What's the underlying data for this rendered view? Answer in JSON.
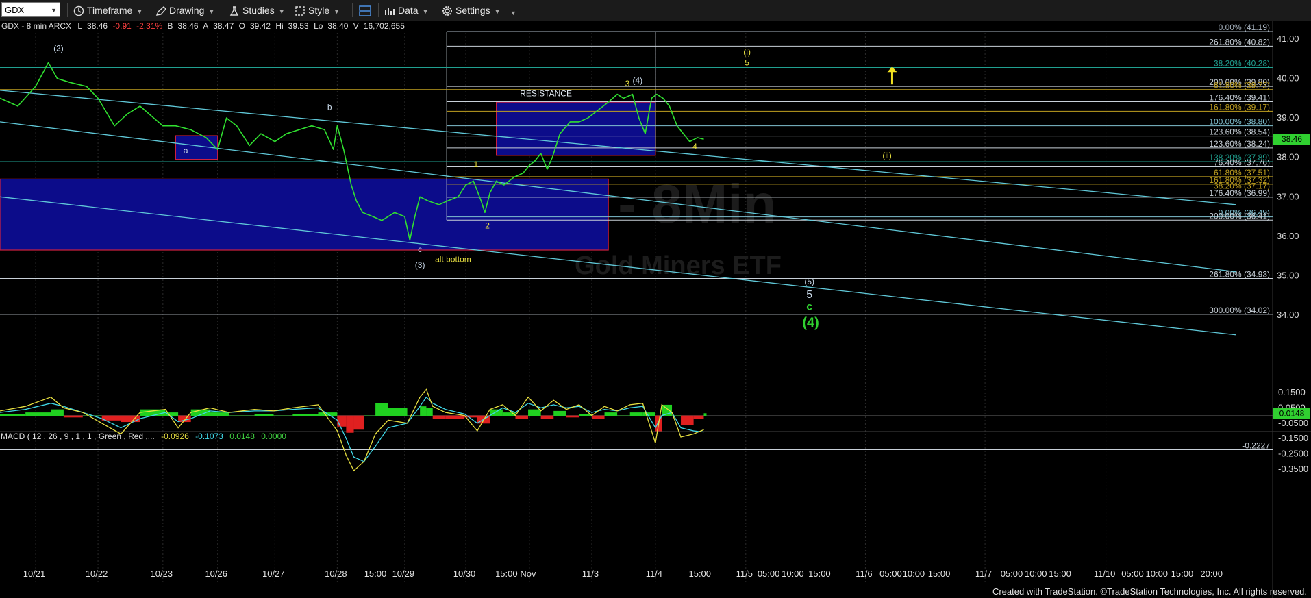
{
  "toolbar": {
    "symbol": "GDX",
    "timeframe": "Timeframe",
    "drawing": "Drawing",
    "studies": "Studies",
    "style": "Style",
    "data": "Data",
    "settings": "Settings"
  },
  "header": {
    "title": "GDX - 8 min  ARCX",
    "last": "L=38.46",
    "change": "-0.91",
    "change_pct": "-2.31%",
    "bid": "B=38.46",
    "ask": "A=38.47",
    "open": "O=39.42",
    "high": "Hi=39.53",
    "low": "Lo=38.40",
    "volume": "V=16,702,655"
  },
  "macd_header": {
    "label": "MACD ( 12 , 26 , 9 , 1 , 1 , Green , Red ,...",
    "v1": "-0.0926",
    "v2": "-0.1073",
    "v3": "0.0148",
    "v4": "0.0000"
  },
  "chart_data": {
    "type": "line",
    "title": "GDX - 8 min",
    "watermark": "GDX - 8Min",
    "watermark_sub": "Gold Miners ETF",
    "last_price": "38.46",
    "ylim": [
      33.4,
      41.3
    ],
    "price_ticks": [
      "41.00",
      "40.00",
      "39.00",
      "38.00",
      "37.00",
      "36.00",
      "35.00",
      "34.00"
    ],
    "price_tick_values": [
      41,
      40,
      39,
      38,
      37,
      36,
      35,
      34
    ],
    "xlim": [
      0,
      1000
    ],
    "x_labels": [
      {
        "x": 28,
        "text": "10/21"
      },
      {
        "x": 77,
        "text": "10/22"
      },
      {
        "x": 128,
        "text": "10/23"
      },
      {
        "x": 171,
        "text": "10/26"
      },
      {
        "x": 216,
        "text": "10/27"
      },
      {
        "x": 265,
        "text": "10/28"
      },
      {
        "x": 296,
        "text": "15:00"
      },
      {
        "x": 318,
        "text": "10/29"
      },
      {
        "x": 366,
        "text": "10/30"
      },
      {
        "x": 399,
        "text": "15:00"
      },
      {
        "x": 416,
        "text": "Nov"
      },
      {
        "x": 465,
        "text": "11/3"
      },
      {
        "x": 515,
        "text": "11/4"
      },
      {
        "x": 551,
        "text": "15:00"
      },
      {
        "x": 586,
        "text": "11/5"
      },
      {
        "x": 605,
        "text": "05:00"
      },
      {
        "x": 624,
        "text": "10:00"
      },
      {
        "x": 645,
        "text": "15:00"
      },
      {
        "x": 680,
        "text": "11/6"
      },
      {
        "x": 701,
        "text": "05:00"
      },
      {
        "x": 719,
        "text": "10:00"
      },
      {
        "x": 739,
        "text": "15:00"
      },
      {
        "x": 774,
        "text": "11/7"
      },
      {
        "x": 796,
        "text": "05:00"
      },
      {
        "x": 815,
        "text": "10:00"
      },
      {
        "x": 834,
        "text": "15:00"
      },
      {
        "x": 869,
        "text": "11/10"
      },
      {
        "x": 891,
        "text": "05:00"
      },
      {
        "x": 910,
        "text": "10:00"
      },
      {
        "x": 930,
        "text": "15:00"
      },
      {
        "x": 953,
        "text": "20:00"
      }
    ],
    "price_series": {
      "x": [
        0,
        14,
        28,
        38,
        45,
        55,
        68,
        77,
        90,
        100,
        110,
        128,
        138,
        150,
        162,
        171,
        178,
        186,
        196,
        205,
        216,
        225,
        235,
        245,
        255,
        262,
        265,
        270,
        276,
        280,
        285,
        293,
        300,
        310,
        318,
        322,
        326,
        330,
        336,
        345,
        352,
        360,
        366,
        372,
        378,
        381,
        385,
        390,
        396,
        404,
        411,
        416,
        420,
        425,
        430,
        434,
        440,
        448,
        455,
        462,
        470,
        478,
        485,
        490,
        497,
        502,
        507,
        512,
        516,
        521,
        526,
        532,
        537,
        542,
        548,
        553
      ],
      "y": [
        39.5,
        39.3,
        39.8,
        40.4,
        40.0,
        39.9,
        39.8,
        39.5,
        38.8,
        39.1,
        39.3,
        38.8,
        38.8,
        38.7,
        38.5,
        38.2,
        39.0,
        38.8,
        38.3,
        38.6,
        38.4,
        38.6,
        38.7,
        38.8,
        38.7,
        38.2,
        38.8,
        38.2,
        37.3,
        36.9,
        36.6,
        36.5,
        36.4,
        36.6,
        36.5,
        35.9,
        36.5,
        37.0,
        36.9,
        36.8,
        36.9,
        37.0,
        37.3,
        37.4,
        36.9,
        36.6,
        37.1,
        37.4,
        37.3,
        37.5,
        37.6,
        37.8,
        37.9,
        38.1,
        37.7,
        38.0,
        38.6,
        38.9,
        38.9,
        39.0,
        39.2,
        39.4,
        39.6,
        39.5,
        39.6,
        39.0,
        38.6,
        39.5,
        39.6,
        39.5,
        39.3,
        38.8,
        38.6,
        38.4,
        38.5,
        38.46
      ]
    },
    "fib_levels": [
      {
        "label": "0.00% (41.19)",
        "value": 41.19,
        "color": "#a8b4c0"
      },
      {
        "label": "261.80% (40.82)",
        "value": 40.82,
        "color": "#c8d0d8"
      },
      {
        "label": "38.20% (40.28)",
        "value": 40.28,
        "color": "#20a090"
      },
      {
        "label": "200.00% (39.80)",
        "value": 39.8,
        "color": "#c8d0d8"
      },
      {
        "label": "61.80% (39.72)",
        "value": 39.72,
        "color": "#c0a020"
      },
      {
        "label": "176.40% (39.41)",
        "value": 39.41,
        "color": "#c8d0d8"
      },
      {
        "label": "161.80% (39.17)",
        "value": 39.17,
        "color": "#c0a020"
      },
      {
        "label": "100.00% (38.80)",
        "value": 38.8,
        "color": "#80c0d0"
      },
      {
        "label": "123.60% (38.54)",
        "value": 38.54,
        "color": "#c8d0d8"
      },
      {
        "label": "123.60% (38.24)",
        "value": 38.24,
        "color": "#c8d0d8"
      },
      {
        "label": "138.20% (37.89)",
        "value": 37.89,
        "color": "#20a090"
      },
      {
        "label": "76.40% (37.76)",
        "value": 37.76,
        "color": "#c8d0d8"
      },
      {
        "label": "61.80% (37.51)",
        "value": 37.51,
        "color": "#c0a020"
      },
      {
        "label": "161.80% (37.32)",
        "value": 37.32,
        "color": "#c0a020"
      },
      {
        "label": "38.20% (37.17)",
        "value": 37.17,
        "color": "#c0a020"
      },
      {
        "label": "176.40% (36.99)",
        "value": 36.99,
        "color": "#c8d0d8"
      },
      {
        "label": "0.00% (36.49)",
        "value": 36.49,
        "color": "#80c0d0"
      },
      {
        "label": "200.00% (36.41)",
        "value": 36.41,
        "color": "#c8d0d8"
      },
      {
        "label": "261.80% (34.93)",
        "value": 34.93,
        "color": "#c8d0d8"
      },
      {
        "label": "300.00% (34.02)",
        "value": 34.02,
        "color": "#c8d0d8"
      }
    ],
    "channel_lines": [
      {
        "x1": 0,
        "y1": 39.7,
        "x2": 971,
        "y2": 36.8
      },
      {
        "x1": 0,
        "y1": 38.9,
        "x2": 971,
        "y2": 35.1
      },
      {
        "x1": 0,
        "y1": 37.0,
        "x2": 971,
        "y2": 33.5
      }
    ],
    "boxes": [
      {
        "name": "resistance",
        "x1": 390,
        "x2": 515,
        "y_top": 39.4,
        "y_bottom": 38.05
      },
      {
        "name": "support",
        "x1": 0,
        "x2": 478,
        "y_top": 37.45,
        "y_bottom": 35.65
      },
      {
        "name": "wave-a",
        "x1": 138,
        "x2": 171,
        "y_top": 38.55,
        "y_bottom": 37.95
      }
    ],
    "annotations": [
      {
        "text": "(2)",
        "x": 46,
        "y": 40.7,
        "color": "#c8d8e8"
      },
      {
        "text": "b",
        "x": 259,
        "y": 39.2,
        "color": "#c8d8e8"
      },
      {
        "text": "a",
        "x": 146,
        "y": 38.1,
        "color": "#c8d8e8"
      },
      {
        "text": "c",
        "x": 330,
        "y": 35.6,
        "color": "#c8d8e8"
      },
      {
        "text": "(3)",
        "x": 330,
        "y": 35.2,
        "color": "#c8d8e8"
      },
      {
        "text": "alt bottom",
        "x": 356,
        "y": 35.35,
        "color": "#e8e040"
      },
      {
        "text": "1",
        "x": 374,
        "y": 37.75,
        "color": "#e8e040"
      },
      {
        "text": "2",
        "x": 383,
        "y": 36.2,
        "color": "#e8e040"
      },
      {
        "text": "RESISTANCE",
        "x": 429,
        "y": 39.55,
        "color": "#e0e8f0"
      },
      {
        "text": "3",
        "x": 493,
        "y": 39.8,
        "color": "#e8e040"
      },
      {
        "text": "(4)",
        "x": 501,
        "y": 39.88,
        "color": "#c8d8e8"
      },
      {
        "text": "4",
        "x": 546,
        "y": 38.2,
        "color": "#e8e040"
      },
      {
        "text": "(i)",
        "x": 587,
        "y": 40.6,
        "color": "#e8e040"
      },
      {
        "text": "5",
        "x": 587,
        "y": 40.33,
        "color": "#e8e040"
      },
      {
        "text": "(ii)",
        "x": 697,
        "y": 37.98,
        "color": "#e8e040"
      },
      {
        "text": "(5)",
        "x": 636,
        "y": 34.78,
        "color": "#c8d8e8"
      },
      {
        "text": "5",
        "x": 636,
        "y": 34.43,
        "color": "#c8d8e8"
      },
      {
        "text": "c",
        "x": 636,
        "y": 34.13,
        "color": "#30d030"
      },
      {
        "text": "(4)",
        "x": 637,
        "y": 33.7,
        "color": "#30d030"
      }
    ],
    "arrow": {
      "x": 701,
      "y_from": 39.85,
      "y_to": 40.3
    },
    "macd": {
      "ylim": [
        -0.4,
        0.2
      ],
      "ticks": [
        "0.1500",
        "0.0500",
        "-0.0500",
        "-0.1500",
        "-0.2500",
        "-0.3500"
      ],
      "tick_values": [
        0.15,
        0.05,
        -0.05,
        -0.15,
        -0.25,
        -0.35
      ],
      "last_value": "0.0148",
      "ref_level_label": "-0.2227",
      "ref_level": -0.2227,
      "x": [
        0,
        20,
        40,
        50,
        65,
        80,
        95,
        110,
        130,
        140,
        150,
        165,
        180,
        200,
        215,
        230,
        250,
        265,
        272,
        278,
        286,
        295,
        305,
        320,
        330,
        335,
        340,
        350,
        365,
        375,
        385,
        395,
        405,
        415,
        425,
        435,
        445,
        455,
        465,
        475,
        485,
        495,
        505,
        515,
        520,
        528,
        535,
        545,
        553
      ],
      "macd_line": [
        0.03,
        0.06,
        0.12,
        0.05,
        0.02,
        -0.05,
        -0.12,
        0.02,
        0.04,
        -0.08,
        0.02,
        0.05,
        0.02,
        0.04,
        0.03,
        0.05,
        0.07,
        -0.1,
        -0.26,
        -0.36,
        -0.3,
        -0.12,
        -0.03,
        -0.05,
        0.12,
        0.17,
        0.06,
        0.02,
        0.0,
        -0.1,
        0.04,
        0.07,
        0.0,
        0.12,
        0.03,
        0.1,
        0.04,
        0.07,
        0.0,
        0.06,
        0.03,
        0.07,
        0.08,
        -0.18,
        0.07,
        0.02,
        -0.14,
        -0.12,
        -0.0926
      ],
      "signal_line": [
        0.02,
        0.04,
        0.08,
        0.06,
        0.02,
        -0.02,
        -0.08,
        -0.02,
        0.02,
        -0.04,
        -0.02,
        0.03,
        0.02,
        0.03,
        0.03,
        0.04,
        0.05,
        -0.03,
        -0.15,
        -0.27,
        -0.3,
        -0.2,
        -0.08,
        -0.05,
        0.06,
        0.12,
        0.08,
        0.04,
        0.01,
        -0.05,
        0.0,
        0.05,
        0.02,
        0.08,
        0.05,
        0.07,
        0.05,
        0.06,
        0.02,
        0.04,
        0.03,
        0.05,
        0.06,
        -0.08,
        0.0,
        0.02,
        -0.08,
        -0.1,
        -0.1073
      ],
      "hist": [
        0.01,
        0.02,
        0.04,
        -0.01,
        0.0,
        -0.03,
        -0.04,
        0.04,
        0.02,
        -0.04,
        0.04,
        0.02,
        0.0,
        0.01,
        0.0,
        0.01,
        0.02,
        -0.07,
        -0.11,
        -0.09,
        0.0,
        0.08,
        0.05,
        0.0,
        0.06,
        0.05,
        -0.02,
        -0.02,
        -0.01,
        -0.05,
        0.04,
        0.02,
        -0.02,
        0.04,
        -0.02,
        0.03,
        -0.01,
        0.01,
        -0.02,
        0.02,
        0.0,
        0.02,
        0.02,
        -0.1,
        0.07,
        0.0,
        -0.06,
        -0.02,
        0.0148
      ]
    }
  },
  "footer": {
    "credit": "Created with TradeStation. ©TradeStation Technologies, Inc. All rights reserved."
  }
}
